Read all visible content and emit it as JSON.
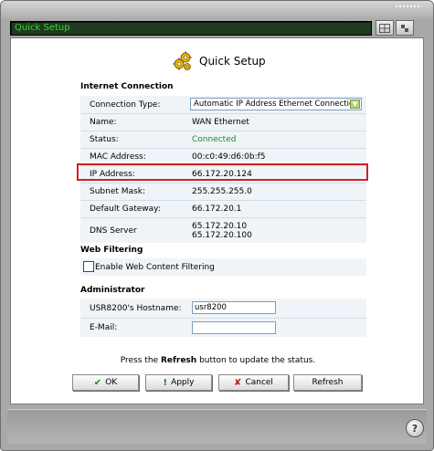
{
  "window": {
    "title": "Quick Setup"
  },
  "header": {
    "title": "Quick Setup"
  },
  "internet": {
    "section_title": "Internet Connection",
    "connection_type_label": "Connection Type:",
    "connection_type_value": "Automatic IP Address Ethernet Connection",
    "rows": [
      {
        "label": "Name:",
        "value": "WAN Ethernet"
      },
      {
        "label": "Status:",
        "value": "Connected"
      },
      {
        "label": "MAC Address:",
        "value": "00:c0:49:d6:0b:f5"
      },
      {
        "label": "IP Address:",
        "value": "66.172.20.124"
      },
      {
        "label": "Subnet Mask:",
        "value": "255.255.255.0"
      },
      {
        "label": "Default Gateway:",
        "value": "66.172.20.1"
      }
    ],
    "dns_label": "DNS Server",
    "dns_values": [
      "65.172.20.10",
      "65.172.20.100"
    ]
  },
  "web_filtering": {
    "section_title": "Web Filtering",
    "checkbox_label": "Enable Web Content Filtering",
    "checked": false
  },
  "administrator": {
    "section_title": "Administrator",
    "hostname_label": "USR8200's Hostname:",
    "hostname_value": "usr8200",
    "email_label": "E-Mail:",
    "email_value": ""
  },
  "note": {
    "prefix": "Press the ",
    "bold": "Refresh",
    "suffix": " button to update the status."
  },
  "buttons": {
    "ok": "OK",
    "apply": "Apply",
    "cancel": "Cancel",
    "refresh": "Refresh"
  },
  "colors": {
    "status_connected": "#1a8a1a",
    "highlight_border": "#d22020",
    "title_text": "#2fdb2f"
  }
}
